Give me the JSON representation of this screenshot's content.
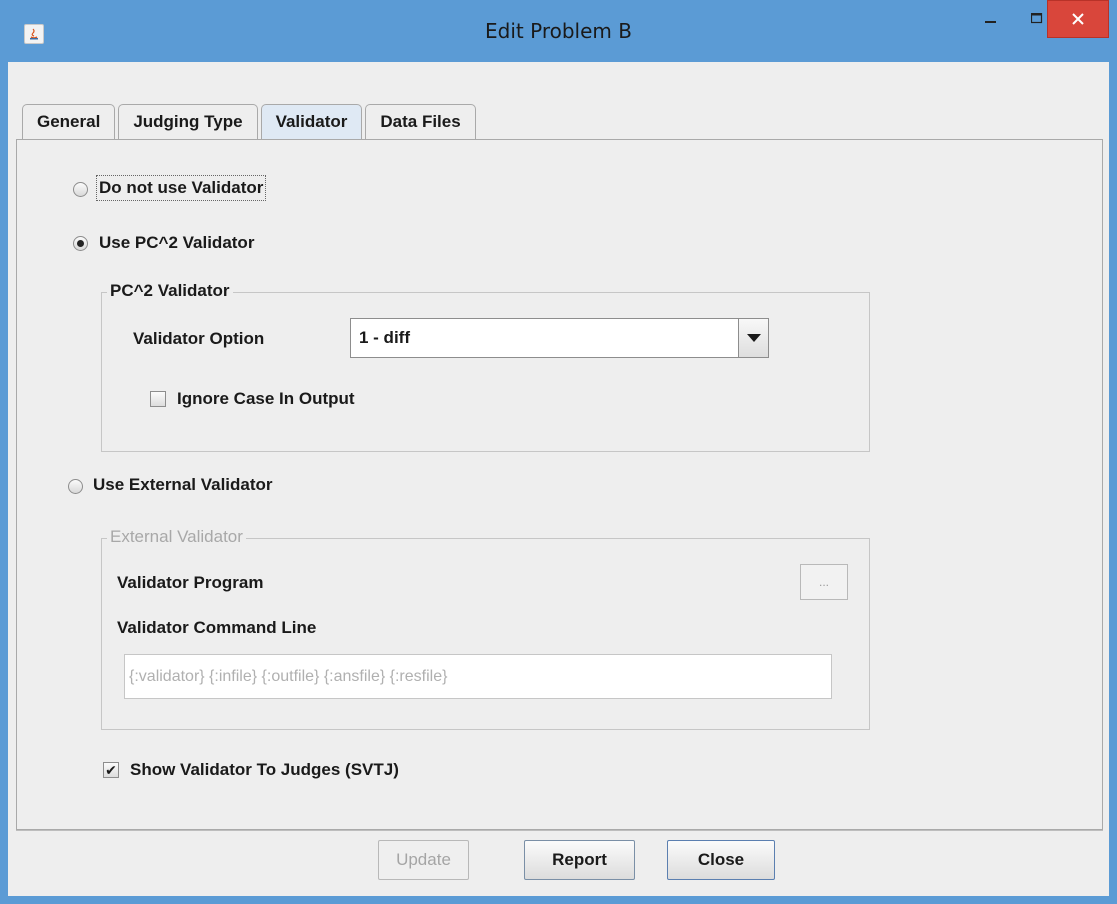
{
  "window": {
    "title": "Edit Problem B",
    "minimize_glyph": "–",
    "maximize_glyph": "□",
    "close_glyph": "✕"
  },
  "tabs": [
    {
      "label": "General"
    },
    {
      "label": "Judging Type"
    },
    {
      "label": "Validator"
    },
    {
      "label": "Data Files"
    }
  ],
  "options": {
    "no_validator": "Do not use Validator",
    "pc2_validator": "Use PC^2 Validator",
    "external_validator": "Use External Validator"
  },
  "pc2_group": {
    "title": "PC^2 Validator",
    "option_label": "Validator Option",
    "option_value": "1 - diff",
    "ignore_case_label": "Ignore Case In Output"
  },
  "external_group": {
    "title": "External Validator",
    "program_label": "Validator Program",
    "browse_label": "...",
    "command_label": "Validator Command Line",
    "command_value": "{:validator} {:infile} {:outfile} {:ansfile} {:resfile}"
  },
  "svtj": {
    "label": "Show Validator To Judges (SVTJ)",
    "checked_glyph": "✔"
  },
  "buttons": {
    "update": "Update",
    "report": "Report",
    "close": "Close"
  },
  "colors": {
    "titlebar": "#5b9bd5",
    "close_button": "#d9463b",
    "dialog_bg": "#eeeeee"
  }
}
